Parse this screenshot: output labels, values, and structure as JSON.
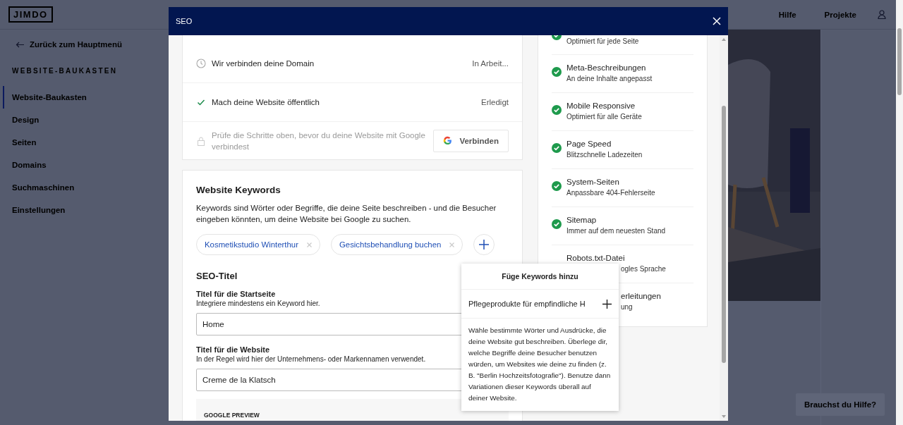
{
  "header": {
    "logo": "JIMDO",
    "links": [
      "Hilfe",
      "Projekte"
    ]
  },
  "sidebar": {
    "back": "Zurück zum Hauptmenü",
    "section": "WEBSITE-BAUKASTEN",
    "items": [
      {
        "label": "Website-Baukasten",
        "selected": true
      },
      {
        "label": "Design",
        "selected": false
      },
      {
        "label": "Seiten",
        "selected": false
      },
      {
        "label": "Domains",
        "selected": false
      },
      {
        "label": "Suchmaschinen",
        "selected": false
      },
      {
        "label": "Einstellungen",
        "selected": false
      }
    ]
  },
  "help_button": "Brauchst du Hilfe?",
  "modal": {
    "title": "SEO",
    "steps": [
      {
        "kind": "pending",
        "label": "Wir verbinden deine Domain",
        "status": "In Arbeit..."
      },
      {
        "kind": "done",
        "label": "Mach deine Website öffentlich",
        "status": "Erledigt"
      },
      {
        "kind": "locked",
        "label": "Prüfe die Schritte oben, bevor du deine Website mit Google verbindest",
        "button": "Verbinden"
      }
    ],
    "keywords": {
      "title": "Website Keywords",
      "description": "Keywords sind Wörter oder Begriffe, die deine Seite beschreiben - und die Besucher eingeben könnten, um deine Website bei Google zu suchen.",
      "chips": [
        "Kosmetikstudio Winterthur",
        "Gesichtsbehandlung buchen"
      ]
    },
    "seo_title": {
      "heading": "SEO-Titel",
      "fields": [
        {
          "label": "Titel für die Startseite",
          "hint": "Integriere mindestens ein Keyword hier.",
          "value": "Home"
        },
        {
          "label": "Titel für die Website",
          "hint": "In der Regel wird hier der Unternehmens- oder Markennamen verwendet.",
          "value": "Creme de la Klatsch"
        }
      ]
    },
    "google_preview": {
      "label": "GOOGLE PREVIEW"
    },
    "checklist": [
      {
        "kind": "cut-top",
        "subtitle": "Optimiert für jede Seite"
      },
      {
        "kind": "full",
        "title": "Meta-Beschreibungen",
        "subtitle": "An deine Inhalte angepasst"
      },
      {
        "kind": "full",
        "title": "Mobile Responsive",
        "subtitle": "Optimiert für alle Geräte"
      },
      {
        "kind": "full",
        "title": "Page Speed",
        "subtitle": "Blitzschnelle Ladezeiten"
      },
      {
        "kind": "full",
        "title": "System-Seiten",
        "subtitle": "Anpassbare 404-Fehlerseite"
      },
      {
        "kind": "full",
        "title": "Sitemap",
        "subtitle": "Immer auf dem neuesten Stand"
      },
      {
        "kind": "partly-covered",
        "title": "Robots.txt-Datei",
        "subtitle": "ogles Sprache"
      },
      {
        "kind": "covered",
        "title": "erleitungen",
        "subtitle": "ung"
      }
    ],
    "popover": {
      "title": "Füge Keywords hinzu",
      "input": "Pflegeprodukte für empfindliche H",
      "text": "Wähle bestimmte Wörter und Ausdrücke, die deine Website gut beschreiben. Überlege dir, welche Begriffe deine Besucher benutzen würden, um Websites wie deine zu finden (z. B. \"Berlin Hochzeitsfotografie\"). Benutze dann Variationen dieser Keywords überall auf deiner Website."
    }
  }
}
